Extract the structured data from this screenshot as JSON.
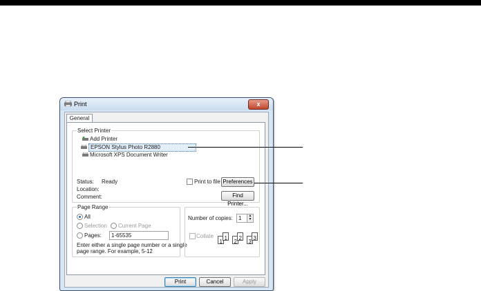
{
  "window": {
    "title": "Print",
    "close_symbol": "x"
  },
  "tabs": [
    {
      "label": "General",
      "selected": true
    }
  ],
  "select_printer": {
    "legend": "Select Printer",
    "printers": [
      {
        "label": "Add Printer",
        "icon": "add-printer-icon"
      },
      {
        "label": "EPSON Stylus Photo R2880",
        "icon": "printer-icon",
        "selected": true
      },
      {
        "label": "Microsoft XPS Document Writer",
        "icon": "printer-icon"
      }
    ],
    "status_label": "Status:",
    "status_value": "Ready",
    "location_label": "Location:",
    "comment_label": "Comment:",
    "print_to_file_label": "Print to file",
    "print_to_file_checked": false,
    "preferences_label": "Preferences",
    "find_printer_label": "Find Printer..."
  },
  "page_range": {
    "legend": "Page Range",
    "all_label": "All",
    "selection_label": "Selection",
    "current_page_label": "Current Page",
    "pages_label": "Pages:",
    "pages_value": "1-65535",
    "help_text_line1": "Enter either a single page number or a single",
    "help_text_line2": "page range.  For example, 5-12",
    "selected_option": "All"
  },
  "copies": {
    "number_label": "Number of copies:",
    "number_value": "1",
    "collate_label": "Collate",
    "collate_checked": false,
    "collate_pages": [
      "1",
      "1",
      "2",
      "2",
      "3",
      "3"
    ]
  },
  "buttons": {
    "print": "Print",
    "cancel": "Cancel",
    "apply": "Apply"
  },
  "colors": {
    "title_bar": "#c9dcee",
    "close_button": "#c0462c",
    "selection": "#3a6ea5",
    "radio_dot": "#2a6bb0"
  }
}
